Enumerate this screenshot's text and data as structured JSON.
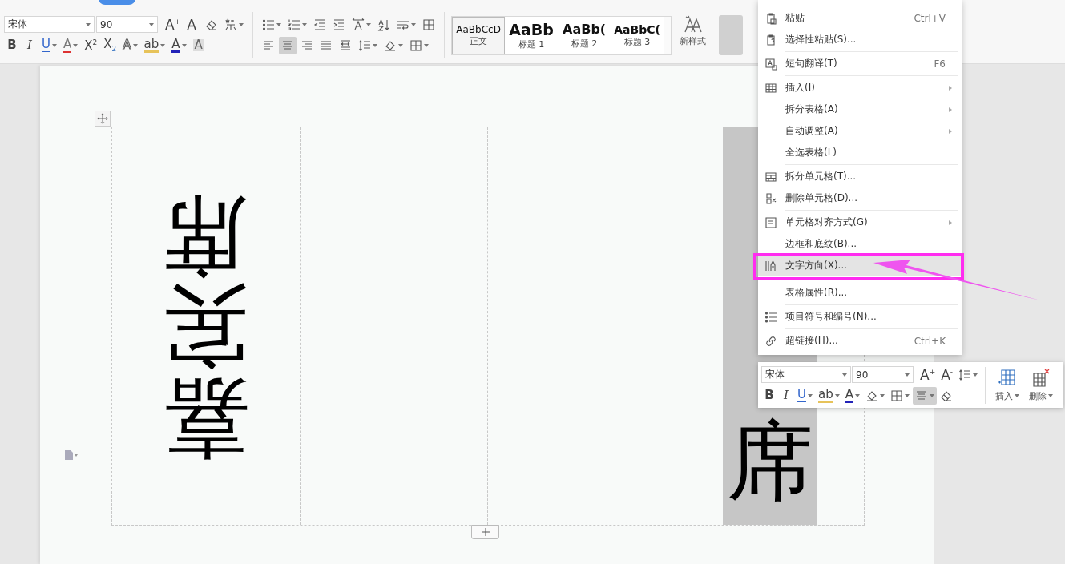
{
  "ribbon": {
    "font_name": "宋体",
    "font_size": "90",
    "size_buttons": [
      {
        "glyph": "A$^{+}$",
        "kind": "text"
      },
      {
        "glyph": "A$^{-}$",
        "kind": "text"
      },
      {
        "kind": "eraser"
      },
      {
        "kind": "phonetic",
        "dropdown": true
      }
    ],
    "format_buttons": [
      {
        "glyph": "B",
        "kind": "bold"
      },
      {
        "glyph": "I",
        "kind": "italic"
      },
      {
        "glyph": "U",
        "kind": "underline",
        "dropdown": true
      },
      {
        "glyph": "A",
        "kind": "strike",
        "dropdown": true
      },
      {
        "glyph": "X$^{2}$",
        "kind": "plain"
      },
      {
        "glyph": "X$_{2}$",
        "kind": "plain"
      },
      {
        "glyph": "A",
        "kind": "outline",
        "dropdown": true
      },
      {
        "glyph": "ab",
        "kind": "highlight",
        "dropdown": true
      },
      {
        "glyph": "A",
        "kind": "color",
        "dropdown": true
      },
      {
        "glyph": "A",
        "kind": "shade"
      }
    ],
    "paragraph_row1": [
      {
        "kind": "bullets",
        "dropdown": true,
        "selected": false
      },
      {
        "kind": "numbering",
        "dropdown": true,
        "selected": false
      },
      {
        "kind": "outdent",
        "selected": false
      },
      {
        "kind": "indent",
        "selected": false
      },
      {
        "kind": "spacing",
        "dropdown": true,
        "selected": false
      },
      {
        "kind": "sort",
        "selected": false
      },
      {
        "kind": "wrap",
        "dropdown": true,
        "selected": false
      },
      {
        "kind": "grid",
        "selected": false
      }
    ],
    "paragraph_row2": [
      {
        "kind": "align-left",
        "selected": false
      },
      {
        "kind": "align-center",
        "selected": true
      },
      {
        "kind": "align-right",
        "selected": false
      },
      {
        "kind": "justify",
        "selected": false
      },
      {
        "kind": "distribute",
        "selected": false
      },
      {
        "kind": "line-spacing",
        "dropdown": true,
        "selected": false
      },
      {
        "kind": "shading",
        "dropdown": true,
        "selected": false
      },
      {
        "kind": "border",
        "dropdown": true,
        "selected": false
      }
    ],
    "styles": [
      {
        "preview": "AaBbCcD",
        "name": "正文",
        "kind": "body",
        "selected": true
      },
      {
        "preview": "AaBb",
        "name": "标题 1",
        "kind": "h1",
        "selected": false
      },
      {
        "preview": "AaBb(",
        "name": "标题 2",
        "kind": "h2",
        "selected": false
      },
      {
        "preview": "AaBbC(",
        "name": "标题 3",
        "kind": "h3",
        "selected": false
      }
    ],
    "new_style": "新样式"
  },
  "table": {
    "cells": [
      {
        "text": "嘉宾席",
        "rotated": true,
        "selected": false
      },
      {
        "selected": false
      },
      {
        "selected": false
      },
      {
        "text": "席",
        "rotated": false,
        "selected": true
      }
    ]
  },
  "context_menu": {
    "items": [
      {
        "kind": "paste",
        "label": "粘贴",
        "shortcut": "Ctrl+V",
        "submenu": false,
        "highlighted": false
      },
      {
        "kind": "query",
        "label": "选择性粘贴(S)...",
        "submenu": false,
        "highlighted": false
      },
      {
        "kind": "separator"
      },
      {
        "kind": "translate",
        "label": "短句翻译(T)",
        "shortcut": "F6",
        "submenu": false,
        "highlighted": false
      },
      {
        "kind": "separator"
      },
      {
        "kind": "table",
        "label": "插入(I)",
        "submenu": true,
        "highlighted": false
      },
      {
        "kind": "plain",
        "label": "拆分表格(A)",
        "submenu": true,
        "highlighted": false
      },
      {
        "kind": "plain",
        "label": "自动调整(A)",
        "submenu": true,
        "highlighted": false
      },
      {
        "kind": "plain",
        "label": "全选表格(L)",
        "submenu": false,
        "highlighted": false
      },
      {
        "kind": "separator"
      },
      {
        "kind": "split",
        "label": "拆分单元格(T)...",
        "submenu": false,
        "highlighted": false
      },
      {
        "kind": "delete",
        "label": "删除单元格(D)...",
        "submenu": false,
        "highlighted": false
      },
      {
        "kind": "separator"
      },
      {
        "kind": "align",
        "label": "单元格对齐方式(G)",
        "submenu": true,
        "highlighted": false
      },
      {
        "kind": "plain",
        "label": "边框和底纹(B)...",
        "submenu": false,
        "highlighted": false
      },
      {
        "kind": "direction",
        "label": "文字方向(X)...",
        "submenu": false,
        "highlighted": true
      },
      {
        "kind": "plain",
        "label": "表格属性(R)...",
        "submenu": false,
        "highlighted": false
      },
      {
        "kind": "separator"
      },
      {
        "kind": "list",
        "label": "项目符号和编号(N)...",
        "submenu": false,
        "highlighted": false
      },
      {
        "kind": "separator"
      },
      {
        "kind": "link",
        "label": "超链接(H)...",
        "shortcut": "Ctrl+K",
        "submenu": false,
        "highlighted": false
      }
    ]
  },
  "mini_toolbar": {
    "font_name": "宋体",
    "font_size": "90",
    "row1": [
      {
        "glyph": "A$^{+}$",
        "kind": "text"
      },
      {
        "glyph": "A$^{-}$",
        "kind": "text"
      },
      {
        "kind": "line-spacing",
        "dropdown": true
      }
    ],
    "row2": [
      {
        "glyph": "B",
        "kind": "bold",
        "selected": false
      },
      {
        "glyph": "I",
        "kind": "italic",
        "selected": false
      },
      {
        "glyph": "U",
        "kind": "underline",
        "dropdown": true,
        "selected": false
      },
      {
        "glyph": "ab",
        "kind": "highlight",
        "dropdown": true,
        "selected": false
      },
      {
        "glyph": "A",
        "kind": "color",
        "dropdown": true,
        "selected": false
      },
      {
        "kind": "shading",
        "dropdown": true,
        "selected": false
      },
      {
        "kind": "border",
        "dropdown": true,
        "selected": false
      },
      {
        "kind": "align-center",
        "dropdown": true,
        "selected": true
      },
      {
        "kind": "eraser",
        "selected": false
      }
    ],
    "insert_label": "插入",
    "delete_label": "删除"
  }
}
